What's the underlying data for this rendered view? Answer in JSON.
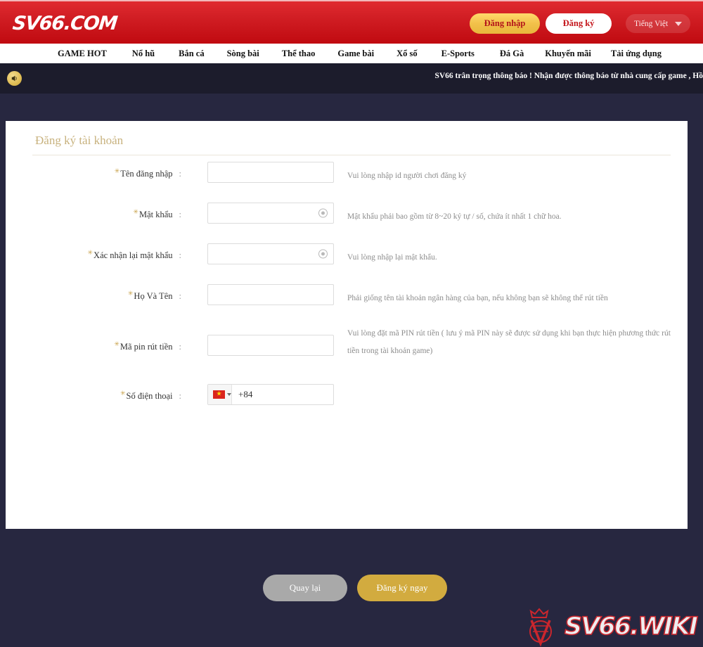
{
  "header": {
    "logo_text": "SV66.COM",
    "login_label": "Đăng nhập",
    "register_label": "Đăng ký",
    "language_label": "Tiếng Việt",
    "language_caret_icon": "chevron-down-icon",
    "accent_red": "#d21f25",
    "accent_gold": "#f2c14a"
  },
  "nav": {
    "items": [
      {
        "label": "GAME HOT"
      },
      {
        "label": "Nổ hũ"
      },
      {
        "label": "Bắn cá"
      },
      {
        "label": "Sòng bài"
      },
      {
        "label": "Thể thao"
      },
      {
        "label": "Game bài"
      },
      {
        "label": "Xổ số"
      },
      {
        "label": "E-Sports"
      },
      {
        "label": "Đá Gà"
      },
      {
        "label": "Khuyến mãi"
      },
      {
        "label": "Tải ứng dụng"
      }
    ]
  },
  "notice": {
    "speaker_icon": "speaker-icon",
    "message": "SV66 trân trọng thông báo ! Nhận được thông báo từ nhà cung cấp game , Hồ",
    "background": "#1c1c2c"
  },
  "form": {
    "title": "Đăng ký tài khoản",
    "title_color": "#c8b27e",
    "required_mark": "✳",
    "colon": ":",
    "eye_icon": "eye-toggle-icon",
    "fields": [
      {
        "label": "Tên đăng nhập",
        "value": "",
        "placeholder": "",
        "hint": "Vui lòng nhập id người chơi đăng ký",
        "has_eye": false
      },
      {
        "label": "Mật khẩu",
        "value": "",
        "placeholder": "",
        "hint": "Mật khẩu phải bao gồm từ 8~20 ký tự / số, chứa ít nhất 1 chữ hoa.",
        "has_eye": true
      },
      {
        "label": "Xác nhận lại mật khẩu",
        "value": "",
        "placeholder": "",
        "hint": "Vui lòng nhập lại mật khẩu.",
        "has_eye": true
      },
      {
        "label": "Họ Và Tên",
        "value": "",
        "placeholder": "",
        "hint": "Phải giống tên tài khoản ngân hàng của bạn, nếu không bạn sẽ không thể rút tiền",
        "has_eye": false
      },
      {
        "label": "Mã pin rút tiền",
        "value": "",
        "placeholder": "",
        "hint": "Vui lòng đặt mã PIN rút tiền ( lưu ý mã PIN này sẽ được sử dụng khi bạn thực hiện phương thức rút tiền trong tài khoản game)",
        "has_eye": false
      }
    ],
    "phone": {
      "label": "Số điện thoại",
      "country_flag_icon": "vietnam-flag-icon",
      "country_caret_icon": "chevron-down-icon",
      "value": "+84",
      "placeholder": ""
    },
    "back_label": "Quay lại",
    "submit_label": "Đăng ký ngay"
  },
  "watermark": {
    "crest_icon": "crown-shield-icon",
    "text": "SV66.WIKI",
    "color": "#d8262c"
  }
}
